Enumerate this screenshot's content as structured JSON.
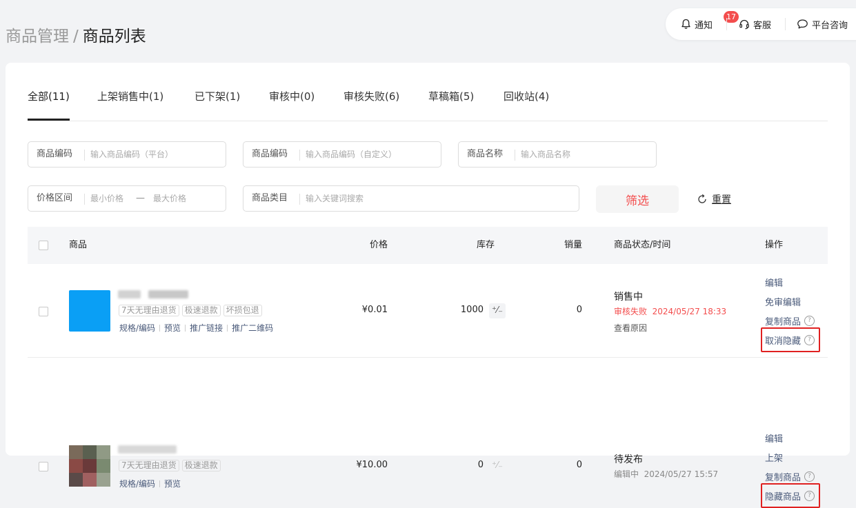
{
  "breadcrumb": {
    "parent": "商品管理",
    "separator": "/",
    "current": "商品列表"
  },
  "topbar": {
    "notify_label": "通知",
    "notify_count": "17",
    "service_label": "客服",
    "consult_label": "平台咨询"
  },
  "tabs": [
    {
      "label": "全部(11)",
      "active": true
    },
    {
      "label": "上架销售中(1)"
    },
    {
      "label": "已下架(1)"
    },
    {
      "label": "审核中(0)"
    },
    {
      "label": "审核失败(6)"
    },
    {
      "label": "草稿箱(5)"
    },
    {
      "label": "回收站(4)"
    }
  ],
  "filters": {
    "code_platform": {
      "label": "商品编码",
      "placeholder": "输入商品编码（平台）"
    },
    "code_custom": {
      "label": "商品编码",
      "placeholder": "输入商品编码（自定义）"
    },
    "name": {
      "label": "商品名称",
      "placeholder": "输入商品名称"
    },
    "price": {
      "label": "价格区间",
      "min_placeholder": "最小价格",
      "dash": "—",
      "max_placeholder": "最大价格"
    },
    "category": {
      "label": "商品类目",
      "placeholder": "输入关键词搜索"
    },
    "filter_button": "筛选",
    "reset_button": "重置"
  },
  "table": {
    "headers": {
      "product": "商品",
      "price": "价格",
      "stock": "库存",
      "sales": "销量",
      "status": "商品状态/时间",
      "actions": "操作"
    },
    "rows": [
      {
        "tags": [
          "7天无理由退货",
          "极速退款",
          "坏损包退"
        ],
        "links": [
          "规格/编码",
          "预览",
          "推广链接",
          "推广二维码"
        ],
        "price": "¥0.01",
        "stock": "1000",
        "stock_edit": "⁺⁄₋",
        "sales": "0",
        "status": "销售中",
        "sub_status": "审核失败  2024/05/27 18:33",
        "sub_status_color": "#f34d4d",
        "status_link": "查看原因",
        "actions": [
          "编辑",
          "免审编辑",
          "复制商品",
          "取消隐藏"
        ],
        "thumb_color": "#0a9ff5"
      },
      {
        "tags": [
          "7天无理由退货",
          "极速退款"
        ],
        "links": [
          "规格/编码",
          "预览"
        ],
        "price": "¥10.00",
        "stock": "0",
        "stock_edit": "⁺⁄₋",
        "sales": "0",
        "status": "待发布",
        "sub_status": "编辑中  2024/05/27 15:57",
        "sub_status_color": "#888888",
        "actions": [
          "编辑",
          "上架",
          "复制商品",
          "隐藏商品"
        ]
      }
    ]
  },
  "colors": {
    "accent": "#f34d4d",
    "link": "#4a5a7a",
    "highlight": "#e02020"
  },
  "icons": [
    "bell-icon",
    "headset-icon",
    "chat-bubble-icon",
    "refresh-icon",
    "help-circle-icon"
  ]
}
